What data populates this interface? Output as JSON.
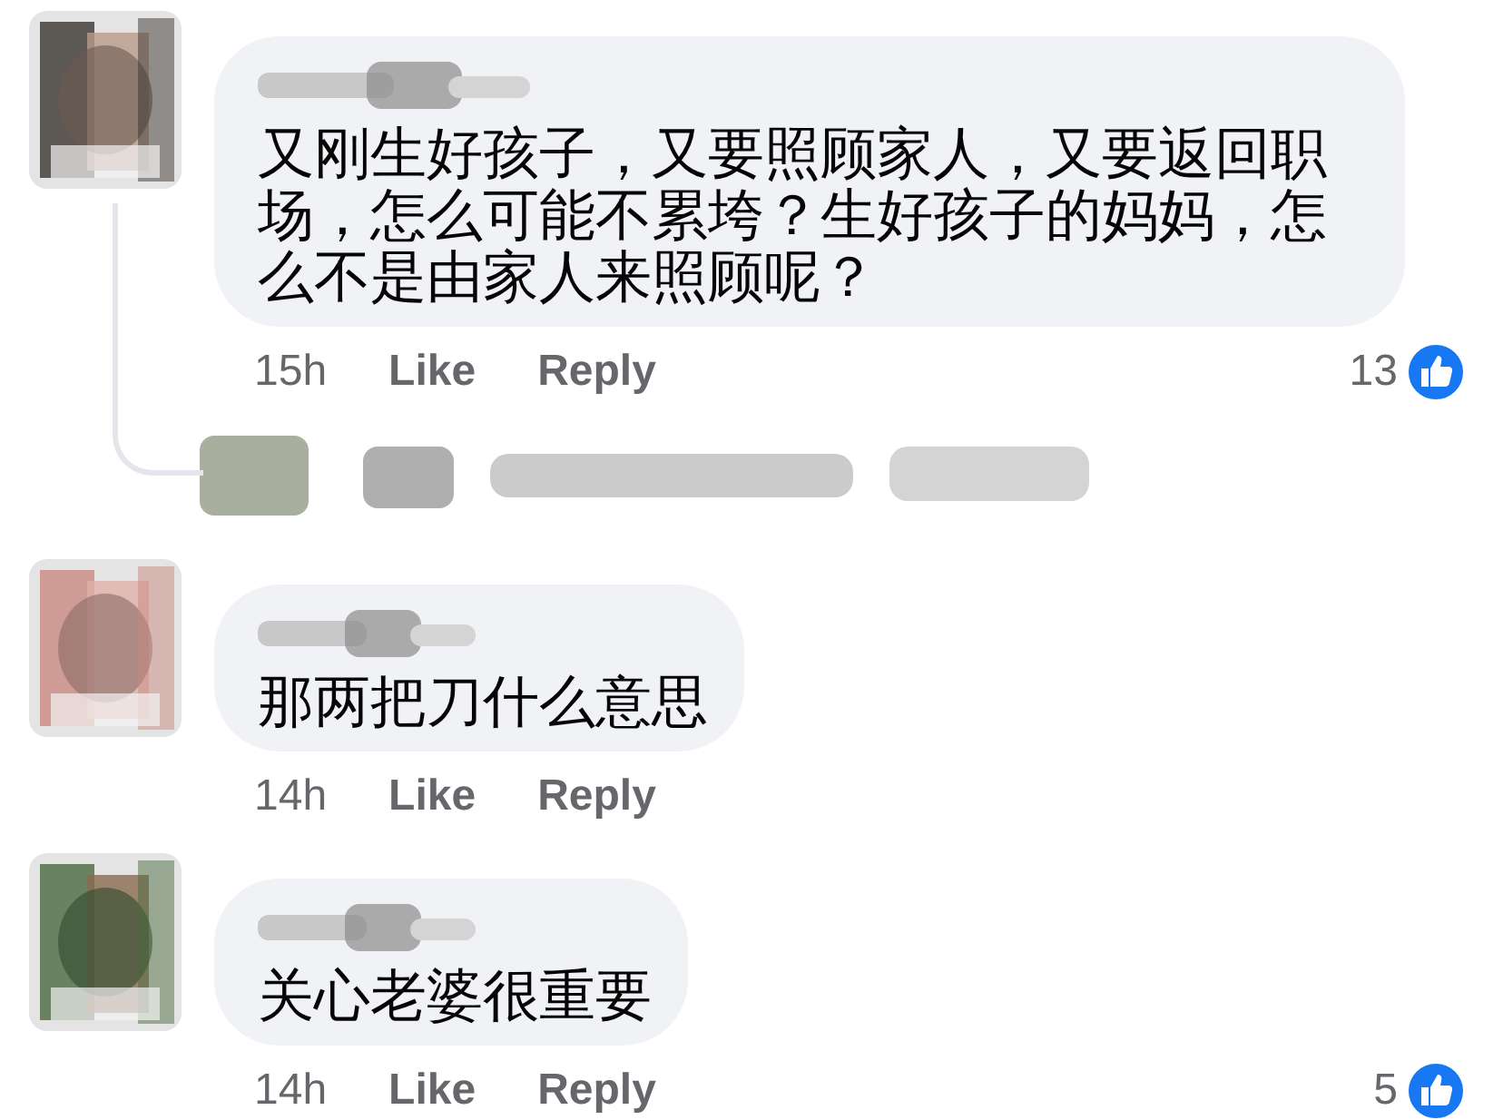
{
  "comments": [
    {
      "text": "又刚生好孩子，又要照顾家人，又要返回职场，怎么可能不累垮？生好孩子的妈妈，怎么不是由家人来照顾呢？",
      "time": "15h",
      "actions": [
        "Like",
        "Reply"
      ],
      "reactions": "13",
      "has_replies": true
    },
    {
      "text": "那两把刀什么意思",
      "time": "14h",
      "actions": [
        "Like",
        "Reply"
      ],
      "has_replies": false
    },
    {
      "text": "关心老婆很重要",
      "time": "14h",
      "actions": [
        "Like",
        "Reply"
      ],
      "reactions": "5",
      "has_replies": false
    }
  ]
}
